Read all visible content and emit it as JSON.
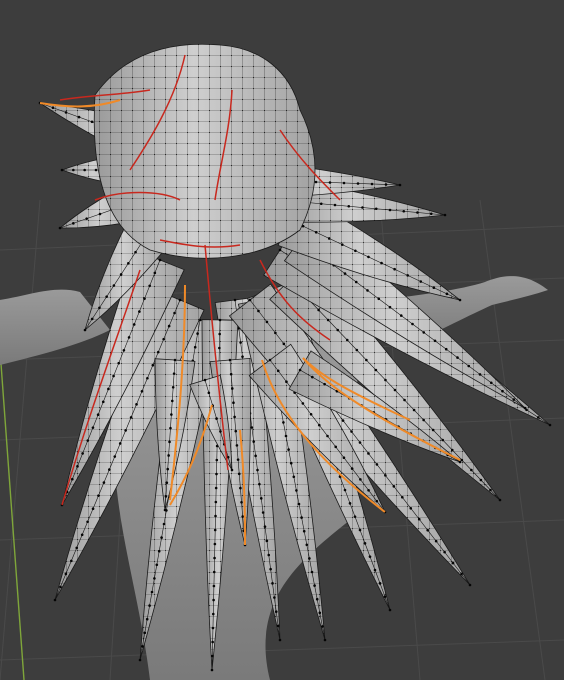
{
  "viewport": {
    "background_color": "#3d3d3d",
    "grid_line_color": "#4a4a4a",
    "y_axis_color": "#7fa63a"
  },
  "colors": {
    "mesh_fill": "#b4b4b4",
    "body_fill": "#8c8c8c",
    "wire": "#141414",
    "vertex": "#050505",
    "seam": "#c8281e",
    "selected_edge": "#f08a28"
  }
}
